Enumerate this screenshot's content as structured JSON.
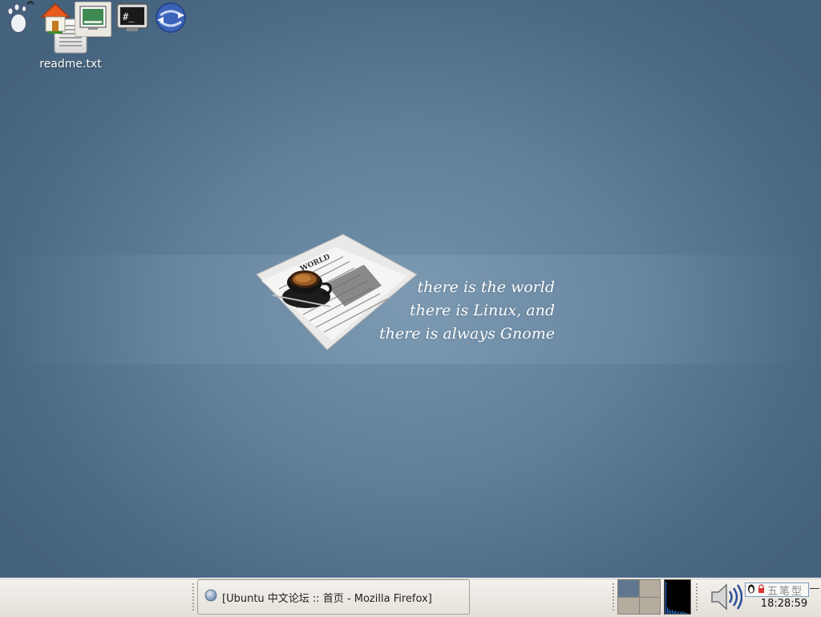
{
  "desktop": {
    "icons": [
      {
        "label": "readme.txt",
        "icon": "text-file-icon"
      }
    ],
    "wallpaper": {
      "headline": "WORLD",
      "slogan": [
        "there is the world",
        "there is Linux, and",
        "there is always Gnome"
      ]
    }
  },
  "panel": {
    "launchers": [
      {
        "name": "gnome-foot-menu",
        "icon": "gnome-foot-icon"
      },
      {
        "name": "home-folder",
        "icon": "home-icon"
      },
      {
        "name": "show-desktop",
        "icon": "show-desktop-icon"
      },
      {
        "name": "terminal",
        "icon": "terminal-icon",
        "glyph": "#_"
      },
      {
        "name": "web-browser",
        "icon": "globe-arrow-icon"
      }
    ],
    "taskbar": {
      "windows": [
        {
          "title": "[Ubuntu 中文论坛 :: 首页 - Mozilla Firefox]",
          "icon": "firefox-icon"
        }
      ]
    },
    "workspaces": {
      "count": 4,
      "active": 0
    },
    "input_method": {
      "label": "五笔型"
    },
    "clock": "18:28:59",
    "colors": {
      "desktop_bg": "#5f7f9b",
      "panel_bg": "#e8e5df",
      "workspace_active": "#60788f",
      "workspace_inactive": "#b5aca0"
    }
  }
}
